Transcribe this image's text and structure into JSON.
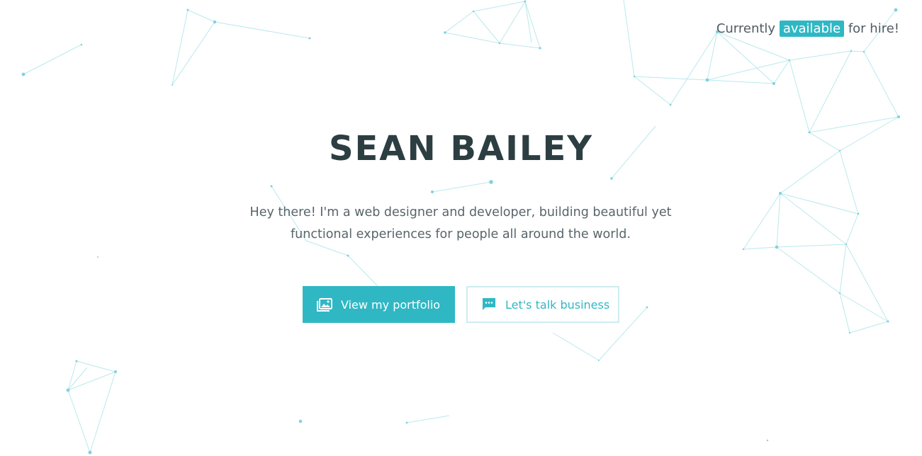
{
  "header": {
    "availability_prefix": "Currently",
    "availability_highlight": "available",
    "availability_suffix": "for hire!"
  },
  "hero": {
    "name": "SEAN BAILEY",
    "intro_line1": "Hey there! I'm a web designer and developer, building beautiful yet",
    "intro_line2": "functional experiences for people all around the world."
  },
  "buttons": {
    "portfolio_label": "View my portfolio",
    "portfolio_icon": "photo-album-icon",
    "contact_label": "Let's talk business",
    "contact_icon": "chat-message-icon"
  },
  "colors": {
    "accent": "#2fb8c4",
    "heading": "#2d3e42",
    "body_text": "#58656b",
    "network_lines": "#a9e3e8"
  }
}
